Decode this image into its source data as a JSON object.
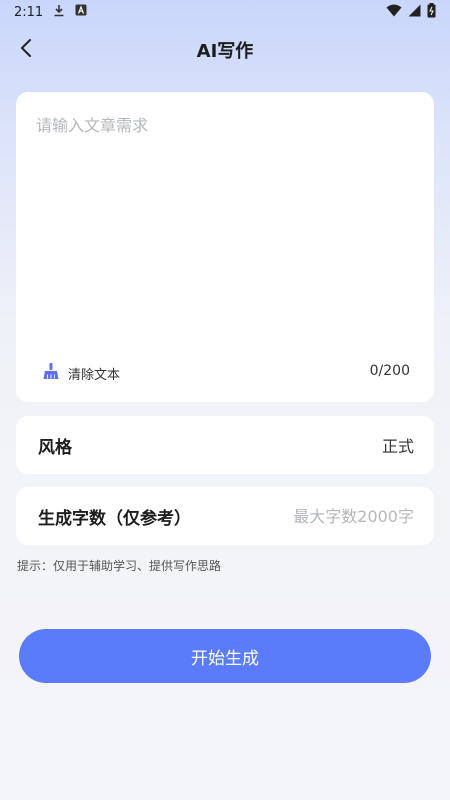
{
  "status_bar": {
    "time": "2:11",
    "icons": [
      "download-icon",
      "a-notification-icon",
      "wifi-icon",
      "signal-icon",
      "battery-icon"
    ]
  },
  "header": {
    "title": "AI写作",
    "back_icon": "chevron-left-icon"
  },
  "editor": {
    "placeholder": "请输入文章需求",
    "value": "",
    "clear_icon": "broom-icon",
    "clear_label": "清除文本",
    "counter": "0/200"
  },
  "style_row": {
    "label": "风格",
    "value": "正式"
  },
  "word_count_row": {
    "label": "生成字数（仅参考）",
    "placeholder": "最大字数2000字",
    "value": ""
  },
  "hint": "提示：仅用于辅助学习、提供写作思路",
  "generate_button": {
    "label": "开始生成"
  },
  "colors": {
    "accent": "#5b7cfa",
    "icon_accent": "#5b6ff0",
    "card": "#ffffff",
    "background_top": "#c9d6fb",
    "background_bottom": "#f4f5f8"
  }
}
